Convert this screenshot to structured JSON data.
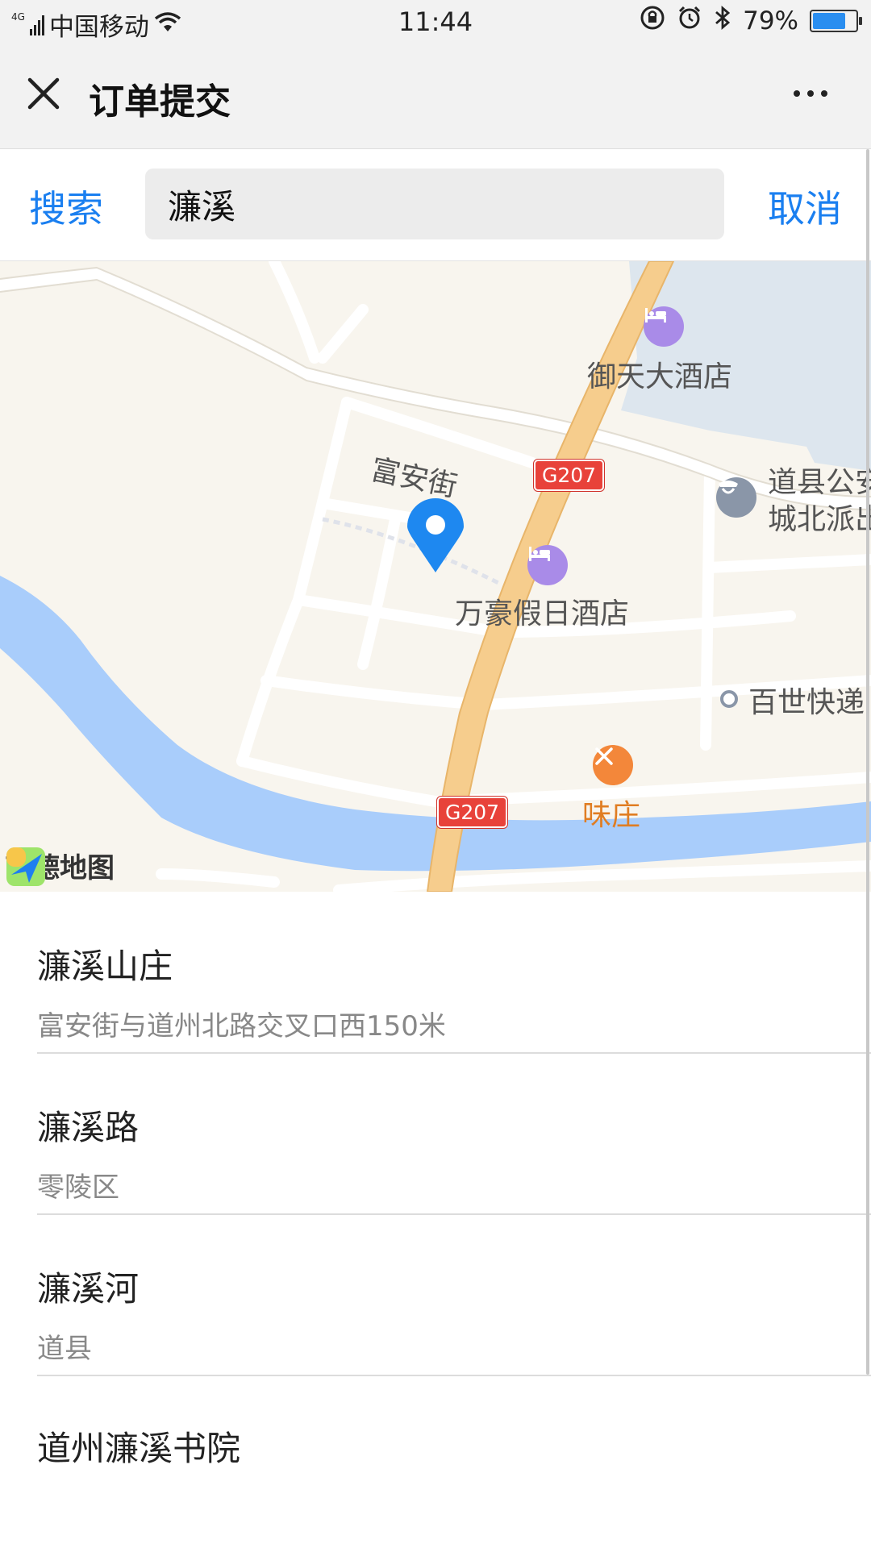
{
  "status_bar": {
    "network": "4G",
    "carrier": "中国移动",
    "time": "11:44",
    "battery": "79%",
    "battery_level": 0.79
  },
  "header": {
    "title": "订单提交",
    "close_icon": "close-icon",
    "more_icon": "more-dots-icon"
  },
  "search": {
    "search_label": "搜索",
    "query": "濂溪",
    "cancel_label": "取消"
  },
  "map": {
    "labels": {
      "road_fuan": "富安街",
      "road_badge_top": "G207",
      "road_badge_bottom": "G207",
      "hotel_yutian": "御天大酒店",
      "hotel_wanhao": "万豪假日酒店",
      "police_line1": "道县公安",
      "police_line2": "城北派出",
      "express": "百世快递",
      "restaurant": "味庄"
    },
    "logo_text": "高德地图",
    "colors": {
      "river": "#a9cdfb",
      "highway": "#f6cd8d",
      "pin": "#1e88f0"
    }
  },
  "results": [
    {
      "name": "濂溪山庄",
      "address": "富安街与道州北路交叉口西150米"
    },
    {
      "name": "濂溪路",
      "address": "零陵区"
    },
    {
      "name": "濂溪河",
      "address": "道县"
    },
    {
      "name": "道州濂溪书院",
      "address": ""
    }
  ]
}
